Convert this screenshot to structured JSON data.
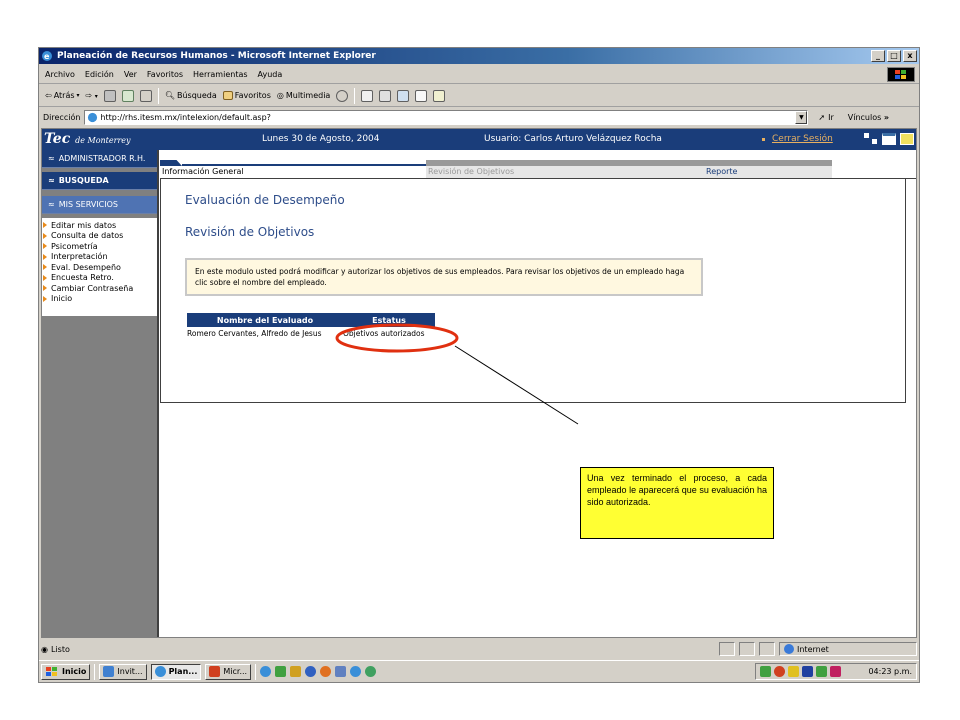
{
  "window": {
    "title": "Planeación de Recursos Humanos - Microsoft Internet Explorer",
    "controls": [
      "_",
      "□",
      "x"
    ]
  },
  "menu": {
    "items": [
      "Archivo",
      "Edición",
      "Ver",
      "Favoritos",
      "Herramientas",
      "Ayuda"
    ]
  },
  "toolbar": {
    "back_label": "Atrás",
    "search_label": "Búsqueda",
    "favorites_label": "Favoritos",
    "multimedia_label": "Multimedia"
  },
  "address": {
    "label": "Dirección",
    "url": "http://rhs.itesm.mx/intelexion/default.asp?",
    "go_label": "Ir",
    "links_label": "Vínculos"
  },
  "site_header": {
    "brand": "Tec",
    "brand_sub": "de Monterrey",
    "date": "Lunes 30 de Agosto, 2004",
    "user": "Usuario: Carlos Arturo Velázquez Rocha",
    "logout": "Cerrar Sesión"
  },
  "sidebar": {
    "buttons": [
      "ADMINISTRADOR R.H.",
      "BUSQUEDA",
      "MIS SERVICIOS"
    ],
    "items": [
      "Editar mis datos",
      "Consulta de datos",
      "Psicometría",
      "Interpretación",
      "Eval. Desempeño",
      "Encuesta Retro.",
      "Cambiar Contraseña",
      "Inicio"
    ]
  },
  "tabs": [
    "Información General",
    "Revisión de Objetivos",
    "Reporte"
  ],
  "main": {
    "title": "Evaluación de Desempeño",
    "subtitle": "Revisión de Objetivos",
    "notice": "En este modulo usted podrá modificar y autorizar los objetivos de sus empleados. Para revisar los objetivos de un empleado haga clic sobre el nombre del empleado.",
    "table": {
      "headers": [
        "Nombre del Evaluado",
        "Estatus"
      ],
      "rows": [
        [
          "Romero Cervantes, Alfredo de Jesus",
          "Objetivos autorizados"
        ]
      ]
    }
  },
  "callout": {
    "text": "Una vez terminado el proceso, a cada empleado le aparecerá que su evaluación ha sido autorizada."
  },
  "status": {
    "left": "Listo",
    "zone": "Internet"
  },
  "taskbar": {
    "start": "Inicio",
    "tasks": [
      "Invit...",
      "Plan...",
      "Micr..."
    ],
    "clock": "04:23 p.m."
  },
  "colors": {
    "header_blue": "#1a3d7a",
    "title_blue": "#2e4d8a",
    "logout_orange": "#e8b060",
    "callout_yellow": "#ffff33",
    "highlight_red": "#e03010"
  }
}
